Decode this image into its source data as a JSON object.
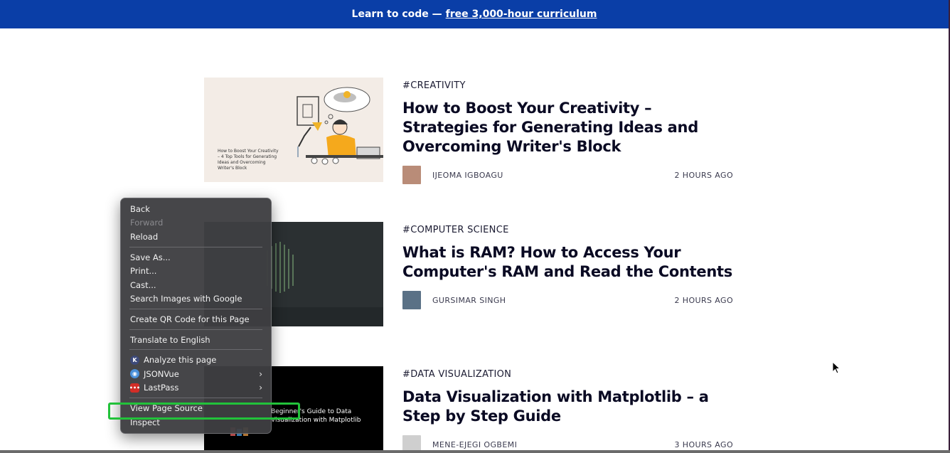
{
  "banner": {
    "text": "Learn to code —",
    "link": "free 3,000-hour curriculum"
  },
  "articles": [
    {
      "tag": "#CREATIVITY",
      "title": "How to Boost Your Creativity – Strategies for Generating Ideas and Overcoming Writer's Block",
      "author": "IJEOMA IGBOAGU",
      "time": "2 HOURS AGO",
      "thumb_caption": "How to Boost Your Creativity – 4 Top Tools for Generating Ideas and Overcoming Writer's Block"
    },
    {
      "tag": "#COMPUTER SCIENCE",
      "title": "What is RAM? How to Access Your Computer's RAM and Read the Contents",
      "author": "GURSIMAR SINGH",
      "time": "2 HOURS AGO"
    },
    {
      "tag": "#DATA VISUALIZATION",
      "title": "Data Visualization with Matplotlib – a Step by Step Guide",
      "author": "MENE-EJEGI OGBEMI",
      "time": "3 HOURS AGO",
      "thumb_caption": "Beginner's Guide to Data Visualization with Matplotlib"
    }
  ],
  "context_menu": {
    "items": [
      {
        "label": "Back"
      },
      {
        "label": "Forward",
        "disabled": true
      },
      {
        "label": "Reload"
      },
      {
        "label": "Save As..."
      },
      {
        "label": "Print..."
      },
      {
        "label": "Cast..."
      },
      {
        "label": "Search Images with Google"
      },
      {
        "label": "Create QR Code for this Page"
      },
      {
        "label": "Translate to English"
      },
      {
        "label": "Analyze this page",
        "icon": "k-extension-icon"
      },
      {
        "label": "JSONVue",
        "icon": "jsonvue-icon",
        "submenu": true
      },
      {
        "label": "LastPass",
        "icon": "lastpass-icon",
        "submenu": true
      },
      {
        "label": "View Page Source",
        "highlighted": true
      },
      {
        "label": "Inspect"
      }
    ],
    "submenu_glyph": "›"
  },
  "colors": {
    "banner_bg": "#0a3ea7",
    "highlight": "#22c23a",
    "menu_bg": "#3e3e42"
  }
}
